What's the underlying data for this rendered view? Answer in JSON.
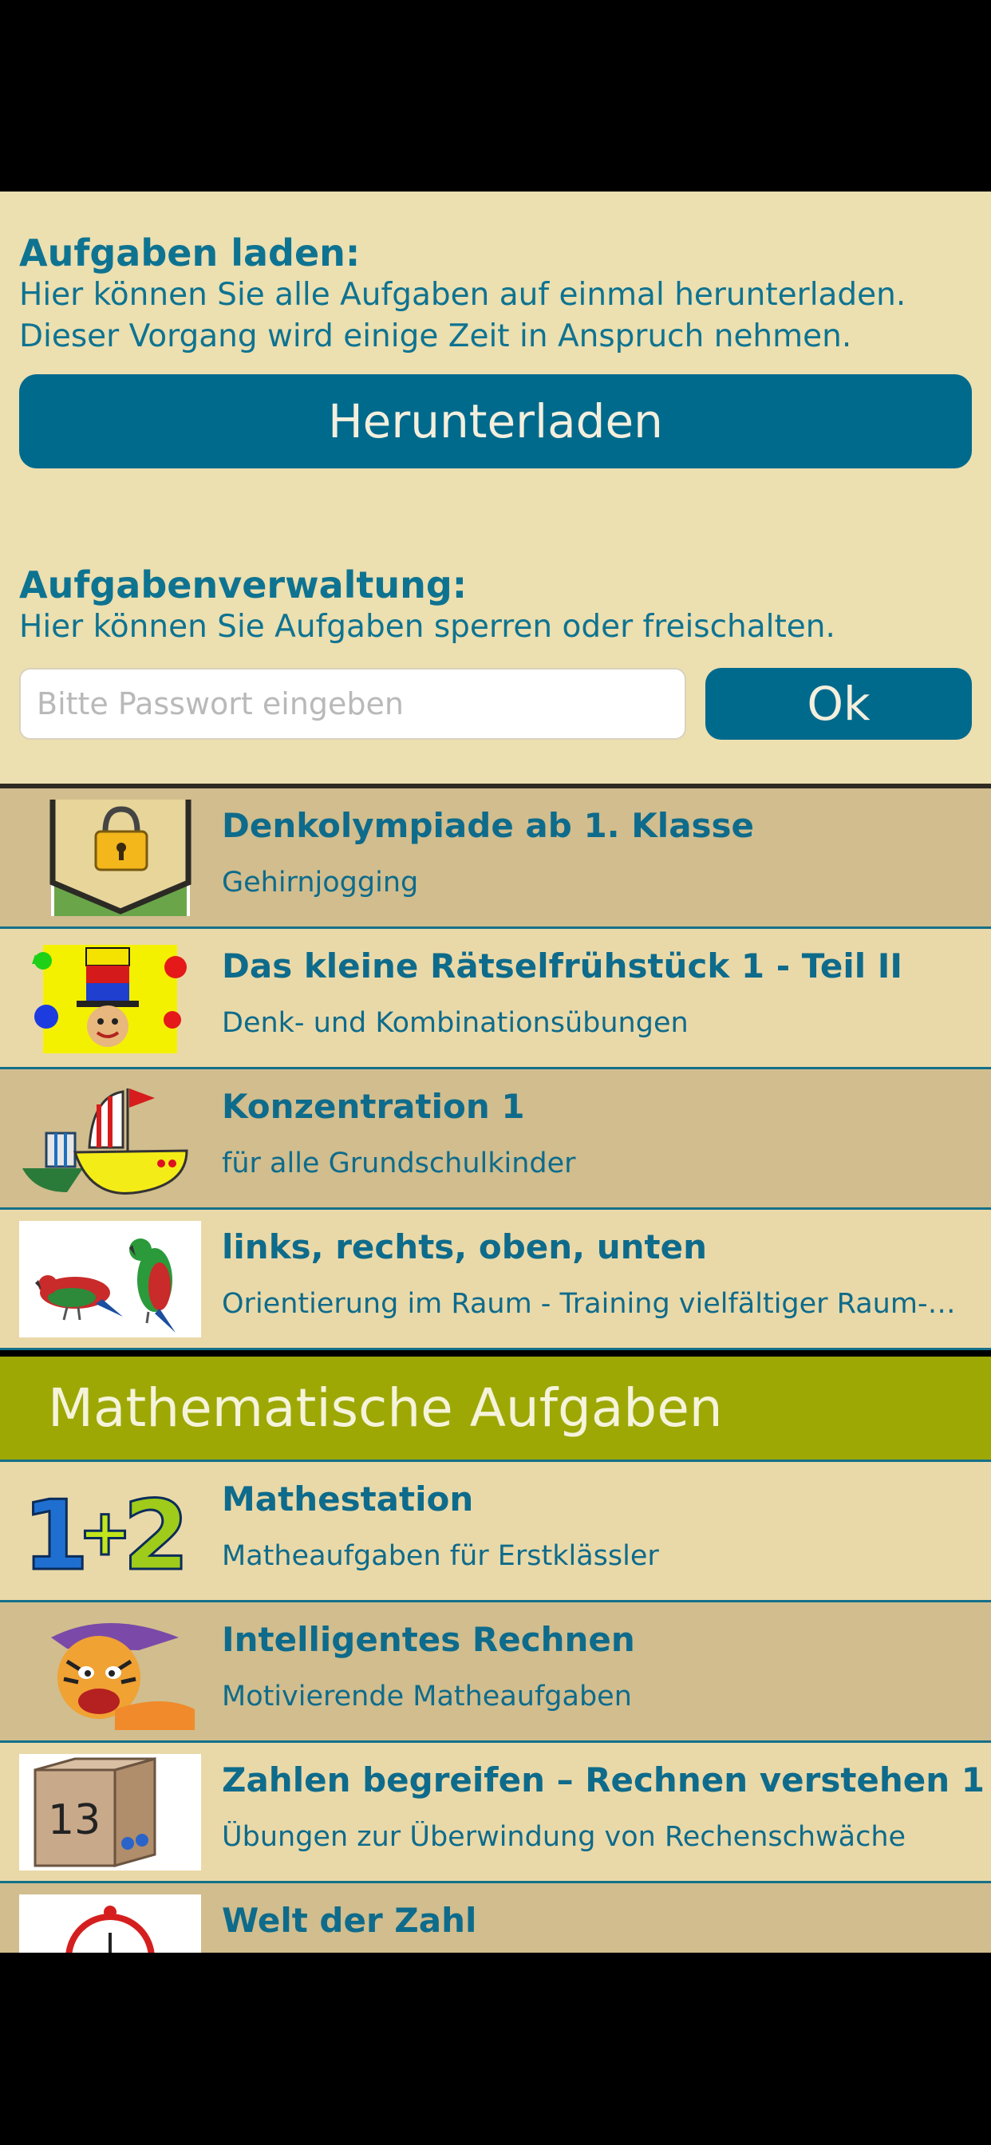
{
  "download_section": {
    "title": "Aufgaben laden:",
    "line1": "Hier können Sie alle Aufgaben auf einmal herunterladen.",
    "line2": "Dieser Vorgang wird einige Zeit in Anspruch nehmen.",
    "button": "Herunterladen"
  },
  "management_section": {
    "title": "Aufgabenverwaltung:",
    "text": "Hier können Sie Aufgaben sperren oder freischalten.",
    "password_placeholder": "Bitte Passwort eingeben",
    "ok_button": "Ok"
  },
  "list": {
    "items": [
      {
        "title": "Denkolympiade ab 1. Klasse",
        "subtitle": "Gehirnjogging",
        "icon": "lock-icon"
      },
      {
        "title": "Das kleine Rätselfrühstück 1 - Teil II",
        "subtitle": "Denk- und Kombinationsübungen",
        "icon": "clown-hat-icon"
      },
      {
        "title": "Konzentration 1",
        "subtitle": "für alle Grundschulkinder",
        "icon": "boats-icon"
      },
      {
        "title": "links, rechts, oben, unten",
        "subtitle": "Orientierung im Raum - Training vielfältiger Raum-…",
        "icon": "parrots-icon"
      }
    ],
    "section_header": "Mathematische Aufgaben",
    "math_items": [
      {
        "title": "Mathestation",
        "subtitle": "Matheaufgaben für Erstklässler",
        "icon": "one-plus-two-icon"
      },
      {
        "title": "Intelligentes Rechnen",
        "subtitle": "Motivierende Matheaufgaben",
        "icon": "tiger-icon"
      },
      {
        "title": "Zahlen begreifen – Rechnen verstehen 1",
        "subtitle": "Übungen zur Überwindung von Rechenschwäche",
        "icon": "box-13-icon"
      },
      {
        "title": "Welt der Zahl",
        "subtitle": "",
        "icon": "clock-icon"
      }
    ]
  },
  "colors": {
    "panel_bg": "#ecdfb0",
    "accent": "#006a8d",
    "text": "#0e7391",
    "section_green": "#9da805"
  }
}
